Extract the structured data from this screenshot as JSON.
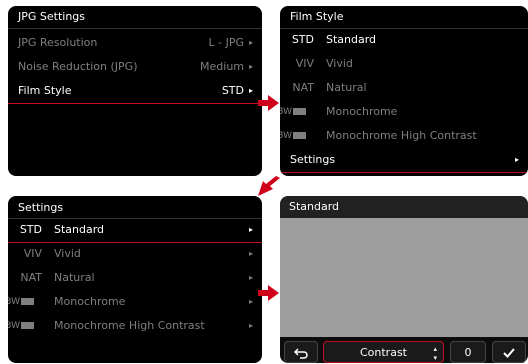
{
  "panel1": {
    "title": "JPG Settings",
    "rows": [
      {
        "label": "JPG Resolution",
        "value": "L - JPG"
      },
      {
        "label": "Noise Reduction (JPG)",
        "value": "Medium"
      },
      {
        "label": "Film Style",
        "value": "STD"
      }
    ]
  },
  "panel2": {
    "title": "Film Style",
    "items": [
      {
        "code": "STD",
        "name": "Standard"
      },
      {
        "code": "VIV",
        "name": "Vivid"
      },
      {
        "code": "NAT",
        "name": "Natural"
      },
      {
        "code": "BW",
        "name": "Monochrome"
      },
      {
        "code": "BW",
        "name": "Monochrome High Contrast"
      }
    ],
    "settings_label": "Settings"
  },
  "panel3": {
    "title": "Settings",
    "items": [
      {
        "code": "STD",
        "name": "Standard"
      },
      {
        "code": "VIV",
        "name": "Vivid"
      },
      {
        "code": "NAT",
        "name": "Natural"
      },
      {
        "code": "BW",
        "name": "Monochrome"
      },
      {
        "code": "BW",
        "name": "Monochrome High Contrast"
      }
    ]
  },
  "panel4": {
    "title": "Standard",
    "back_icon": "back-arrow",
    "param_label": "Contrast",
    "param_value": "0",
    "confirm_icon": "checkmark"
  },
  "colors": {
    "accent": "#c40d1e",
    "panel": "#000000",
    "preview": "#9e9e9e"
  }
}
